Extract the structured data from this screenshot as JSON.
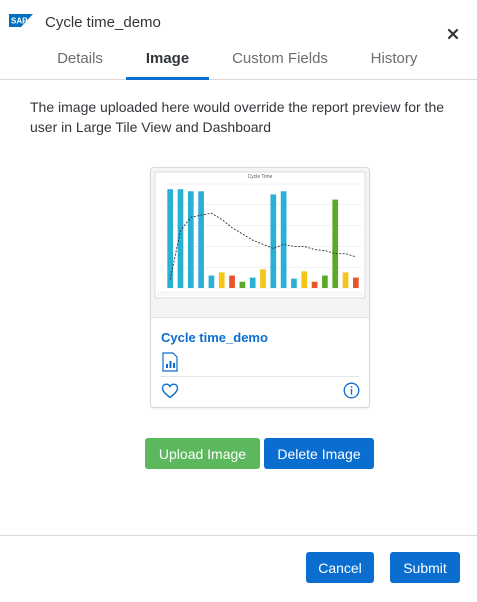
{
  "header": {
    "logo_text": "SAP",
    "title": "Cycle time_demo",
    "close_icon": "close-icon"
  },
  "tabs": [
    {
      "label": "Details",
      "active": false
    },
    {
      "label": "Image",
      "active": true
    },
    {
      "label": "Custom Fields",
      "active": false
    },
    {
      "label": "History",
      "active": false
    }
  ],
  "description": "The image uploaded here would override the report preview for the user in Large Tile View and Dashboard",
  "card": {
    "title": "Cycle time_demo",
    "report_icon": "report-icon",
    "favorite_icon": "heart-icon",
    "info_icon": "info-icon",
    "thumbnail": {
      "chart_title": "Cycle Time",
      "bar_colors": [
        "#2ab0d4",
        "#f5c518",
        "#e8542a",
        "#5aaa2a",
        "#2ab0d4"
      ],
      "bar_heights": [
        0.95,
        0.95,
        0.93,
        0.93,
        0.12,
        0.15,
        0.12,
        0.06,
        0.1,
        0.18,
        0.9,
        0.93,
        0.09,
        0.16,
        0.06,
        0.12,
        0.85,
        0.15,
        0.1
      ],
      "trend": [
        0.08,
        0.55,
        0.68,
        0.7,
        0.72,
        0.66,
        0.58,
        0.52,
        0.46,
        0.42,
        0.38,
        0.42,
        0.4,
        0.4,
        0.37,
        0.36,
        0.33,
        0.33,
        0.3
      ]
    }
  },
  "buttons": {
    "upload": "Upload Image",
    "delete": "Delete Image",
    "cancel": "Cancel",
    "submit": "Submit"
  },
  "colors": {
    "brand_blue": "#0a6ed1",
    "upload_green": "#5cb85c",
    "sap_logo": "#0070c0"
  }
}
